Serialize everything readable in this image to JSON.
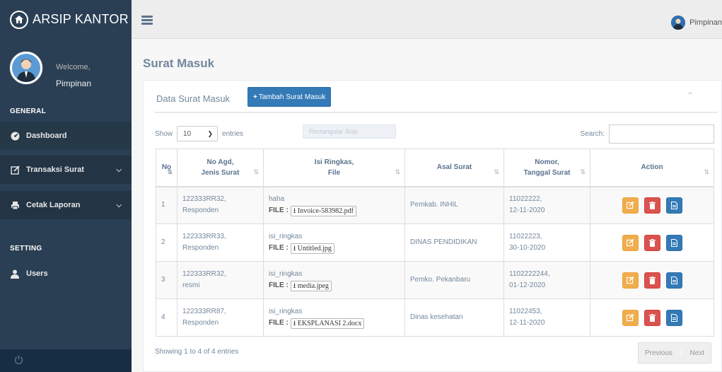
{
  "app": {
    "title": "ARSIP KANTOR"
  },
  "profile": {
    "welcome": "Welcome,",
    "name": "Pimpinan"
  },
  "sidebar": {
    "general_title": "GENERAL",
    "setting_title": "SETTING",
    "items": [
      {
        "label": "Dashboard",
        "icon": "dashboard-icon"
      },
      {
        "label": "Transaksi Surat",
        "icon": "edit-icon",
        "has_submenu": true
      },
      {
        "label": "Cetak Laporan",
        "icon": "print-icon",
        "has_submenu": true
      },
      {
        "label": "Users",
        "icon": "user-icon"
      }
    ]
  },
  "topbar": {
    "user_name": "Pimpinan"
  },
  "page": {
    "title": "Surat Masuk"
  },
  "panel": {
    "title": "Data Surat Masuk",
    "add_button": "Tambah Surat Masuk",
    "ghost_tooltip": "Rectangular Snip"
  },
  "datatable": {
    "show_label": "Show",
    "page_size": "10",
    "entries_label": "entries",
    "search_label": "Search:",
    "search_value": "",
    "headers": {
      "no": "No",
      "agd_line1": "No Agd,",
      "agd_line2": "Jenis Surat",
      "isi_line1": "Isi Ringkas,",
      "isi_line2": "File",
      "asal": "Asal Surat",
      "nomor_line1": "Nomor,",
      "nomor_line2": "Tanggal Surat",
      "action": "Action"
    },
    "file_label": "FILE :",
    "rows": [
      {
        "no": "1",
        "agd": "122333RR32,",
        "jenis": "Responden",
        "isi": "haha",
        "file": "Invoice-583982.pdf",
        "asal": "Pemkab. INHIL",
        "nomor": "11022222,",
        "tanggal": "12-11-2020"
      },
      {
        "no": "2",
        "agd": "122333RR33,",
        "jenis": "Responden",
        "isi": "isi_ringkas",
        "file": "Untitled.jpg",
        "asal": "DINAS PENDIDIKAN",
        "nomor": "11022223,",
        "tanggal": "30-10-2020"
      },
      {
        "no": "3",
        "agd": "122333RR32,",
        "jenis": "resmi",
        "isi": "isi_ringkas",
        "file": "media.jpeg",
        "asal": "Pemko. Pekanbaru",
        "nomor": "1102222244,",
        "tanggal": "01-12-2020"
      },
      {
        "no": "4",
        "agd": "122333RR87,",
        "jenis": "Responden",
        "isi": "isi_ringkas",
        "file": "EKSPLANASI 2.docx",
        "asal": "Dinas kesehatan",
        "nomor": "11022453,",
        "tanggal": "12-11-2020"
      }
    ],
    "info": "Showing 1 to 4 of 4 entries",
    "previous": "Previous",
    "next": "Next"
  },
  "colors": {
    "sidebar": "#2a3f54",
    "primary": "#337ab7",
    "warning": "#f0ad4e",
    "danger": "#d9534f"
  }
}
